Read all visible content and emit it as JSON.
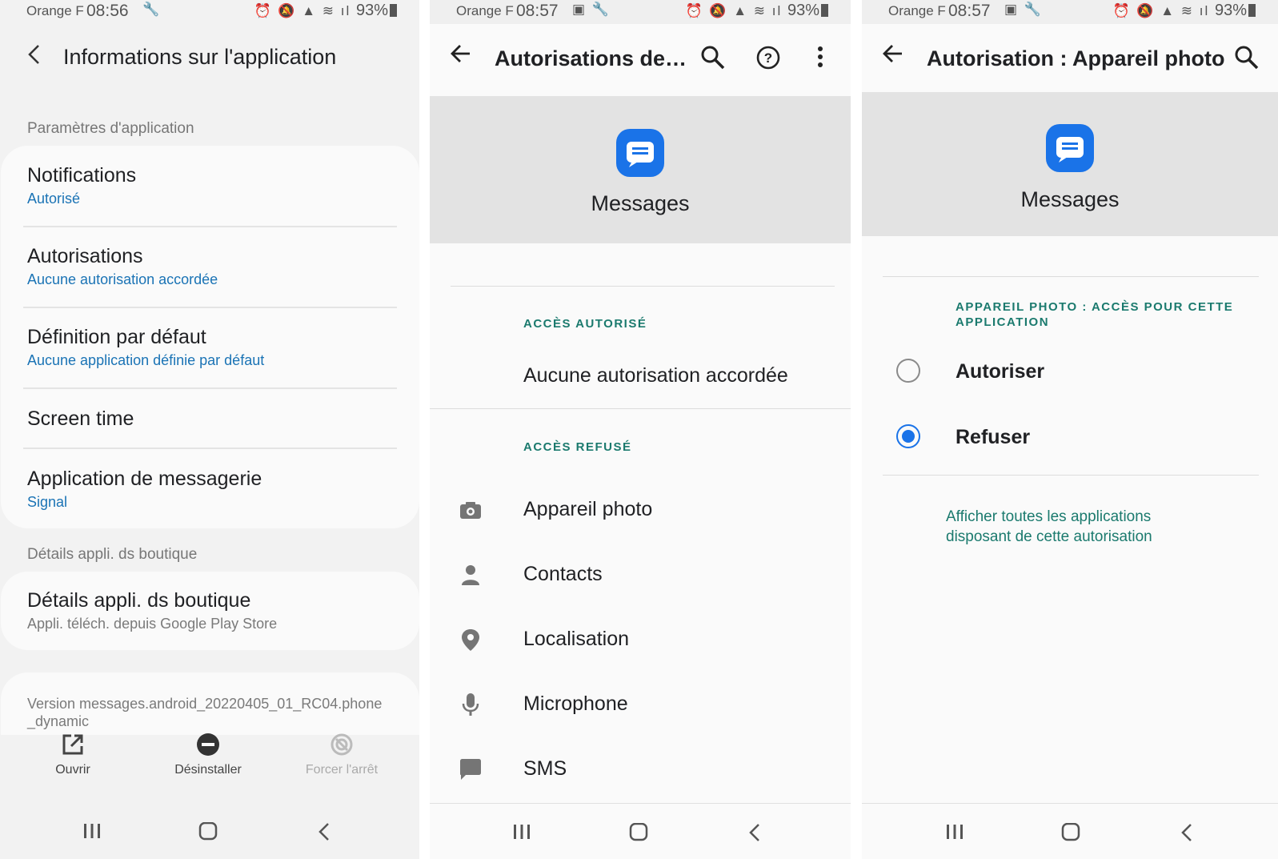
{
  "status_bars": [
    {
      "carrier": "Orange F",
      "time": "08:56",
      "battery": "93%"
    },
    {
      "carrier": "Orange F",
      "time": "08:57",
      "battery": "93%"
    },
    {
      "carrier": "Orange F",
      "time": "08:57",
      "battery": "93%"
    }
  ],
  "app_info": {
    "title": "Informations sur l'application",
    "section_app_settings": "Paramètres d'application",
    "items": [
      {
        "title": "Notifications",
        "subtitle": "Autorisé"
      },
      {
        "title": "Autorisations",
        "subtitle": "Aucune autorisation accordée"
      },
      {
        "title": "Définition par défaut",
        "subtitle": "Aucune application définie par défaut"
      },
      {
        "title": "Screen time",
        "subtitle": ""
      },
      {
        "title": "Application de messagerie",
        "subtitle": "Signal"
      }
    ],
    "section_store": "Détails appli. ds boutique",
    "store_item": {
      "title": "Détails appli. ds boutique",
      "subtitle": "Appli. téléch. depuis Google Play Store"
    },
    "version": "Version messages.android_20220405_01_RC04.phone_dynamic",
    "actions": {
      "open": "Ouvrir",
      "uninstall": "Désinstaller",
      "force_stop": "Forcer l'arrêt"
    }
  },
  "permissions_screen": {
    "title": "Autorisations de…",
    "app_name": "Messages",
    "allowed_header": "ACCÈS AUTORISÉ",
    "allowed_none": "Aucune autorisation accordée",
    "denied_header": "ACCÈS REFUSÉ",
    "denied": [
      {
        "label": "Appareil photo",
        "icon": "camera-icon"
      },
      {
        "label": "Contacts",
        "icon": "person-icon"
      },
      {
        "label": "Localisation",
        "icon": "location-pin-icon"
      },
      {
        "label": "Microphone",
        "icon": "microphone-icon"
      },
      {
        "label": "SMS",
        "icon": "chat-bubble-icon"
      }
    ]
  },
  "camera_permission": {
    "title": "Autorisation : Appareil photo",
    "app_name": "Messages",
    "header": "APPAREIL PHOTO : ACCÈS POUR CETTE APPLICATION",
    "options": [
      {
        "label": "Autoriser",
        "selected": false
      },
      {
        "label": "Refuser",
        "selected": true
      }
    ],
    "link": "Afficher toutes les applications disposant de cette autorisation"
  },
  "colors": {
    "accent_blue": "#1a73e8",
    "link_teal": "#1b7a6e",
    "subtitle_blue": "#1a73b5"
  }
}
